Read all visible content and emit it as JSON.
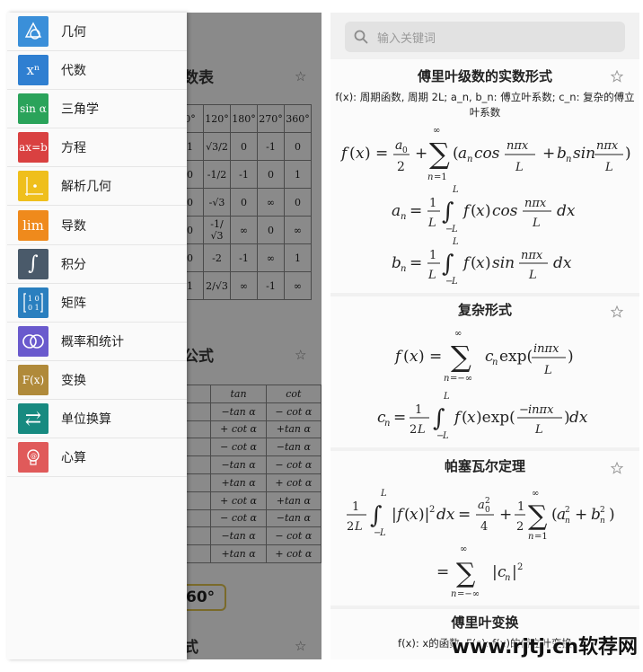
{
  "drawer": {
    "items": [
      {
        "label": "几何",
        "icon": "geometry-icon",
        "icon_text": "",
        "color": "#3a8fd9"
      },
      {
        "label": "代数",
        "icon": "algebra-icon",
        "icon_text": "xⁿ",
        "color": "#2f7fd1"
      },
      {
        "label": "三角学",
        "icon": "trigonometry-icon",
        "icon_text": "sin α",
        "color": "#2aa35a"
      },
      {
        "label": "方程",
        "icon": "equation-icon",
        "icon_text": "ax=b",
        "color": "#d94141"
      },
      {
        "label": "解析几何",
        "icon": "analytic-geometry-icon",
        "icon_text": "",
        "color": "#efbf1c"
      },
      {
        "label": "导数",
        "icon": "derivative-icon",
        "icon_text": "lim",
        "color": "#ef8a1c"
      },
      {
        "label": "积分",
        "icon": "integral-icon",
        "icon_text": "∫",
        "color": "#4a5a6a"
      },
      {
        "label": "矩阵",
        "icon": "matrix-icon",
        "icon_text": "",
        "color": "#2a7fbf"
      },
      {
        "label": "概率和统计",
        "icon": "probability-icon",
        "icon_text": "",
        "color": "#6a5acd"
      },
      {
        "label": "变换",
        "icon": "transform-icon",
        "icon_text": "F(x)",
        "color": "#b08a3a"
      },
      {
        "label": "单位换算",
        "icon": "unit-conversion-icon",
        "icon_text": "⇄",
        "color": "#178a80"
      },
      {
        "label": "心算",
        "icon": "mental-math-icon",
        "icon_text": "",
        "color": "#e05a5a"
      }
    ]
  },
  "background": {
    "title1": "数表",
    "title2": "公式",
    "title3": "式",
    "pill": "60°",
    "table1": [
      [
        "0°",
        "120°",
        "180°",
        "270°",
        "360°"
      ],
      [
        "1",
        "√3/2",
        "0",
        "-1",
        "0"
      ],
      [
        "0",
        "-1/2",
        "-1",
        "0",
        "1"
      ],
      [
        "0",
        "-√3",
        "0",
        "∞",
        "0"
      ],
      [
        "0",
        "-1/√3",
        "∞",
        "0",
        "∞"
      ],
      [
        "0",
        "-2",
        "-1",
        "∞",
        "1"
      ],
      [
        "1",
        "2/√3",
        "∞",
        "-1",
        "∞"
      ]
    ],
    "table2_head": [
      "",
      "tan",
      "cot"
    ],
    "table2": [
      [
        "",
        "−tan α",
        "− cot α"
      ],
      [
        "",
        "+ cot α",
        "+tan α"
      ],
      [
        "",
        "− cot α",
        "−tan α"
      ],
      [
        "",
        "−tan α",
        "− cot α"
      ],
      [
        "",
        "+tan α",
        "+ cot α"
      ],
      [
        "",
        "+ cot α",
        "+tan α"
      ],
      [
        "",
        "− cot α",
        "−tan α"
      ],
      [
        "",
        "−tan α",
        "− cot α"
      ],
      [
        "",
        "+tan α",
        "+ cot α"
      ]
    ]
  },
  "search": {
    "placeholder": "输入关键词"
  },
  "sections": {
    "real_form": {
      "title": "傅里叶级数的实数形式",
      "desc": "f(x): 周期函数, 周期 2L; a_n, b_n: 傅立叶系数; c_n: 复杂的傅立叶系数"
    },
    "complex_form": {
      "title": "复杂形式"
    },
    "parseval": {
      "title": "帕塞瓦尔定理"
    },
    "transform": {
      "title": "傅里叶变换",
      "desc": "f(x): x的函数, F(s): f(x)的傅立叶变换"
    }
  },
  "watermark": "www.rjtj.cn软荐网"
}
